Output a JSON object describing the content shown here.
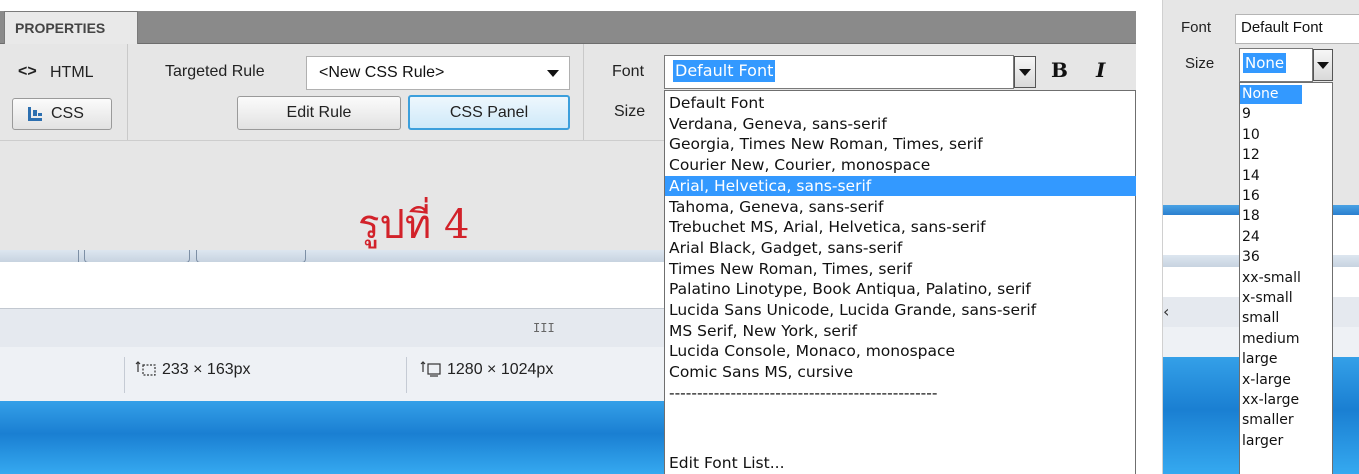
{
  "left_panel": {
    "tab_label": "PROPERTIES",
    "html_button": "HTML",
    "css_button": "CSS",
    "targeted_rule_label": "Targeted Rule",
    "targeted_rule_value": "<New CSS Rule>",
    "edit_rule_button": "Edit Rule",
    "css_panel_button": "CSS Panel",
    "font_label": "Font",
    "font_value": "Default Font",
    "size_label": "Size",
    "bold_button": "B",
    "italic_button": "I",
    "watermark": "รูปที่ 4",
    "scroll_grip": "III",
    "status_dim_1": "233 × 163px",
    "status_dim_2": "1280 × 1024px",
    "font_options": [
      "Default Font",
      "Verdana, Geneva, sans-serif",
      "Georgia, Times New Roman, Times, serif",
      "Courier New, Courier, monospace",
      "Arial, Helvetica, sans-serif",
      "Tahoma, Geneva, sans-serif",
      "Trebuchet MS, Arial, Helvetica, sans-serif",
      "Arial Black, Gadget, sans-serif",
      "Times New Roman, Times, serif",
      "Palatino Linotype, Book Antiqua, Palatino, serif",
      "Lucida Sans Unicode, Lucida Grande, sans-serif",
      "MS Serif, New York, serif",
      "Lucida Console, Monaco, monospace",
      "Comic Sans MS, cursive",
      "------------------------------------------------",
      "Edit Font List..."
    ],
    "selected_font_option": "Arial, Helvetica, sans-serif"
  },
  "right_panel": {
    "font_label": "Font",
    "font_value": "Default Font",
    "size_label": "Size",
    "size_value": "None",
    "left_chevron": "‹",
    "size_options": [
      "None",
      "9",
      "10",
      "12",
      "14",
      "16",
      "18",
      "24",
      "36",
      "xx-small",
      "x-small",
      "small",
      "medium",
      "large",
      "x-large",
      "xx-large",
      "smaller",
      "larger"
    ],
    "selected_size_option": "None"
  },
  "colors": {
    "selection_blue": "#3399ff",
    "active_button_border": "#3c9fdc",
    "watermark_red": "#d2222a",
    "tabbar_gray": "#8a8a8a"
  }
}
